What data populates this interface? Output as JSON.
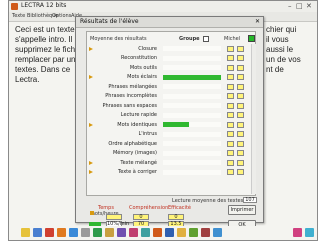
{
  "window": {
    "title": "LECTRA 12 bits"
  },
  "menubar": {
    "items": [
      "Texte",
      "Bibliothèque",
      "Options",
      "Aide"
    ]
  },
  "document": {
    "lines": [
      "Ceci est un texte",
      "s'appelle intro. Il",
      "supprimez le fich",
      "remplacer par un",
      "textes. Dans ce",
      "Lectra."
    ],
    "right_lines": [
      "chier qui",
      "il vous",
      "aussi le",
      "un de vos",
      "nt de",
      ""
    ]
  },
  "dialog": {
    "title": "Résultats de l'élève",
    "close": "✕",
    "header": {
      "left": "Moyenne des résultats",
      "groupe": "Groupe",
      "right": "Michel"
    },
    "rows": [
      {
        "label": "Closure",
        "arrow": true,
        "bar": 0
      },
      {
        "label": "Reconstitution",
        "arrow": false,
        "bar": 0
      },
      {
        "label": "Mots outils",
        "arrow": false,
        "bar": 0
      },
      {
        "label": "Mots éclairs",
        "arrow": true,
        "bar": 1.0
      },
      {
        "label": "Phrases mélangées",
        "arrow": false,
        "bar": 0
      },
      {
        "label": "Phrases incomplètes",
        "arrow": false,
        "bar": 0
      },
      {
        "label": "Phrases sans espaces",
        "arrow": false,
        "bar": 0
      },
      {
        "label": "Lecture rapide",
        "arrow": false,
        "bar": 0
      },
      {
        "label": "Mots identiques",
        "arrow": true,
        "bar": 0.45
      },
      {
        "label": "L'intrus",
        "arrow": false,
        "bar": 0
      },
      {
        "label": "Ordre alphabétique",
        "arrow": false,
        "bar": 0
      },
      {
        "label": "Mémory (images)",
        "arrow": false,
        "bar": 0
      },
      {
        "label": "Texte mélangé",
        "arrow": true,
        "bar": 0
      },
      {
        "label": "Texte à corriger",
        "arrow": true,
        "bar": 0
      }
    ],
    "footer": {
      "global_label": "Lecture moyenne des textes",
      "global_value": "107",
      "col_temps": "Temps",
      "col_comprehension": "Compréhension",
      "col_efficacite": "Efficacité",
      "temps_sub": "mots/heure",
      "values_row1": [
        "",
        "0",
        "0"
      ],
      "values_row2": [
        "10%/min",
        "70",
        "13.5"
      ],
      "btn_imprimer": "Imprimer",
      "btn_ok": "OK"
    }
  },
  "colors": {
    "bar": "#2fb830",
    "yellow": "#fff47a",
    "arrow": "#d89a10"
  }
}
